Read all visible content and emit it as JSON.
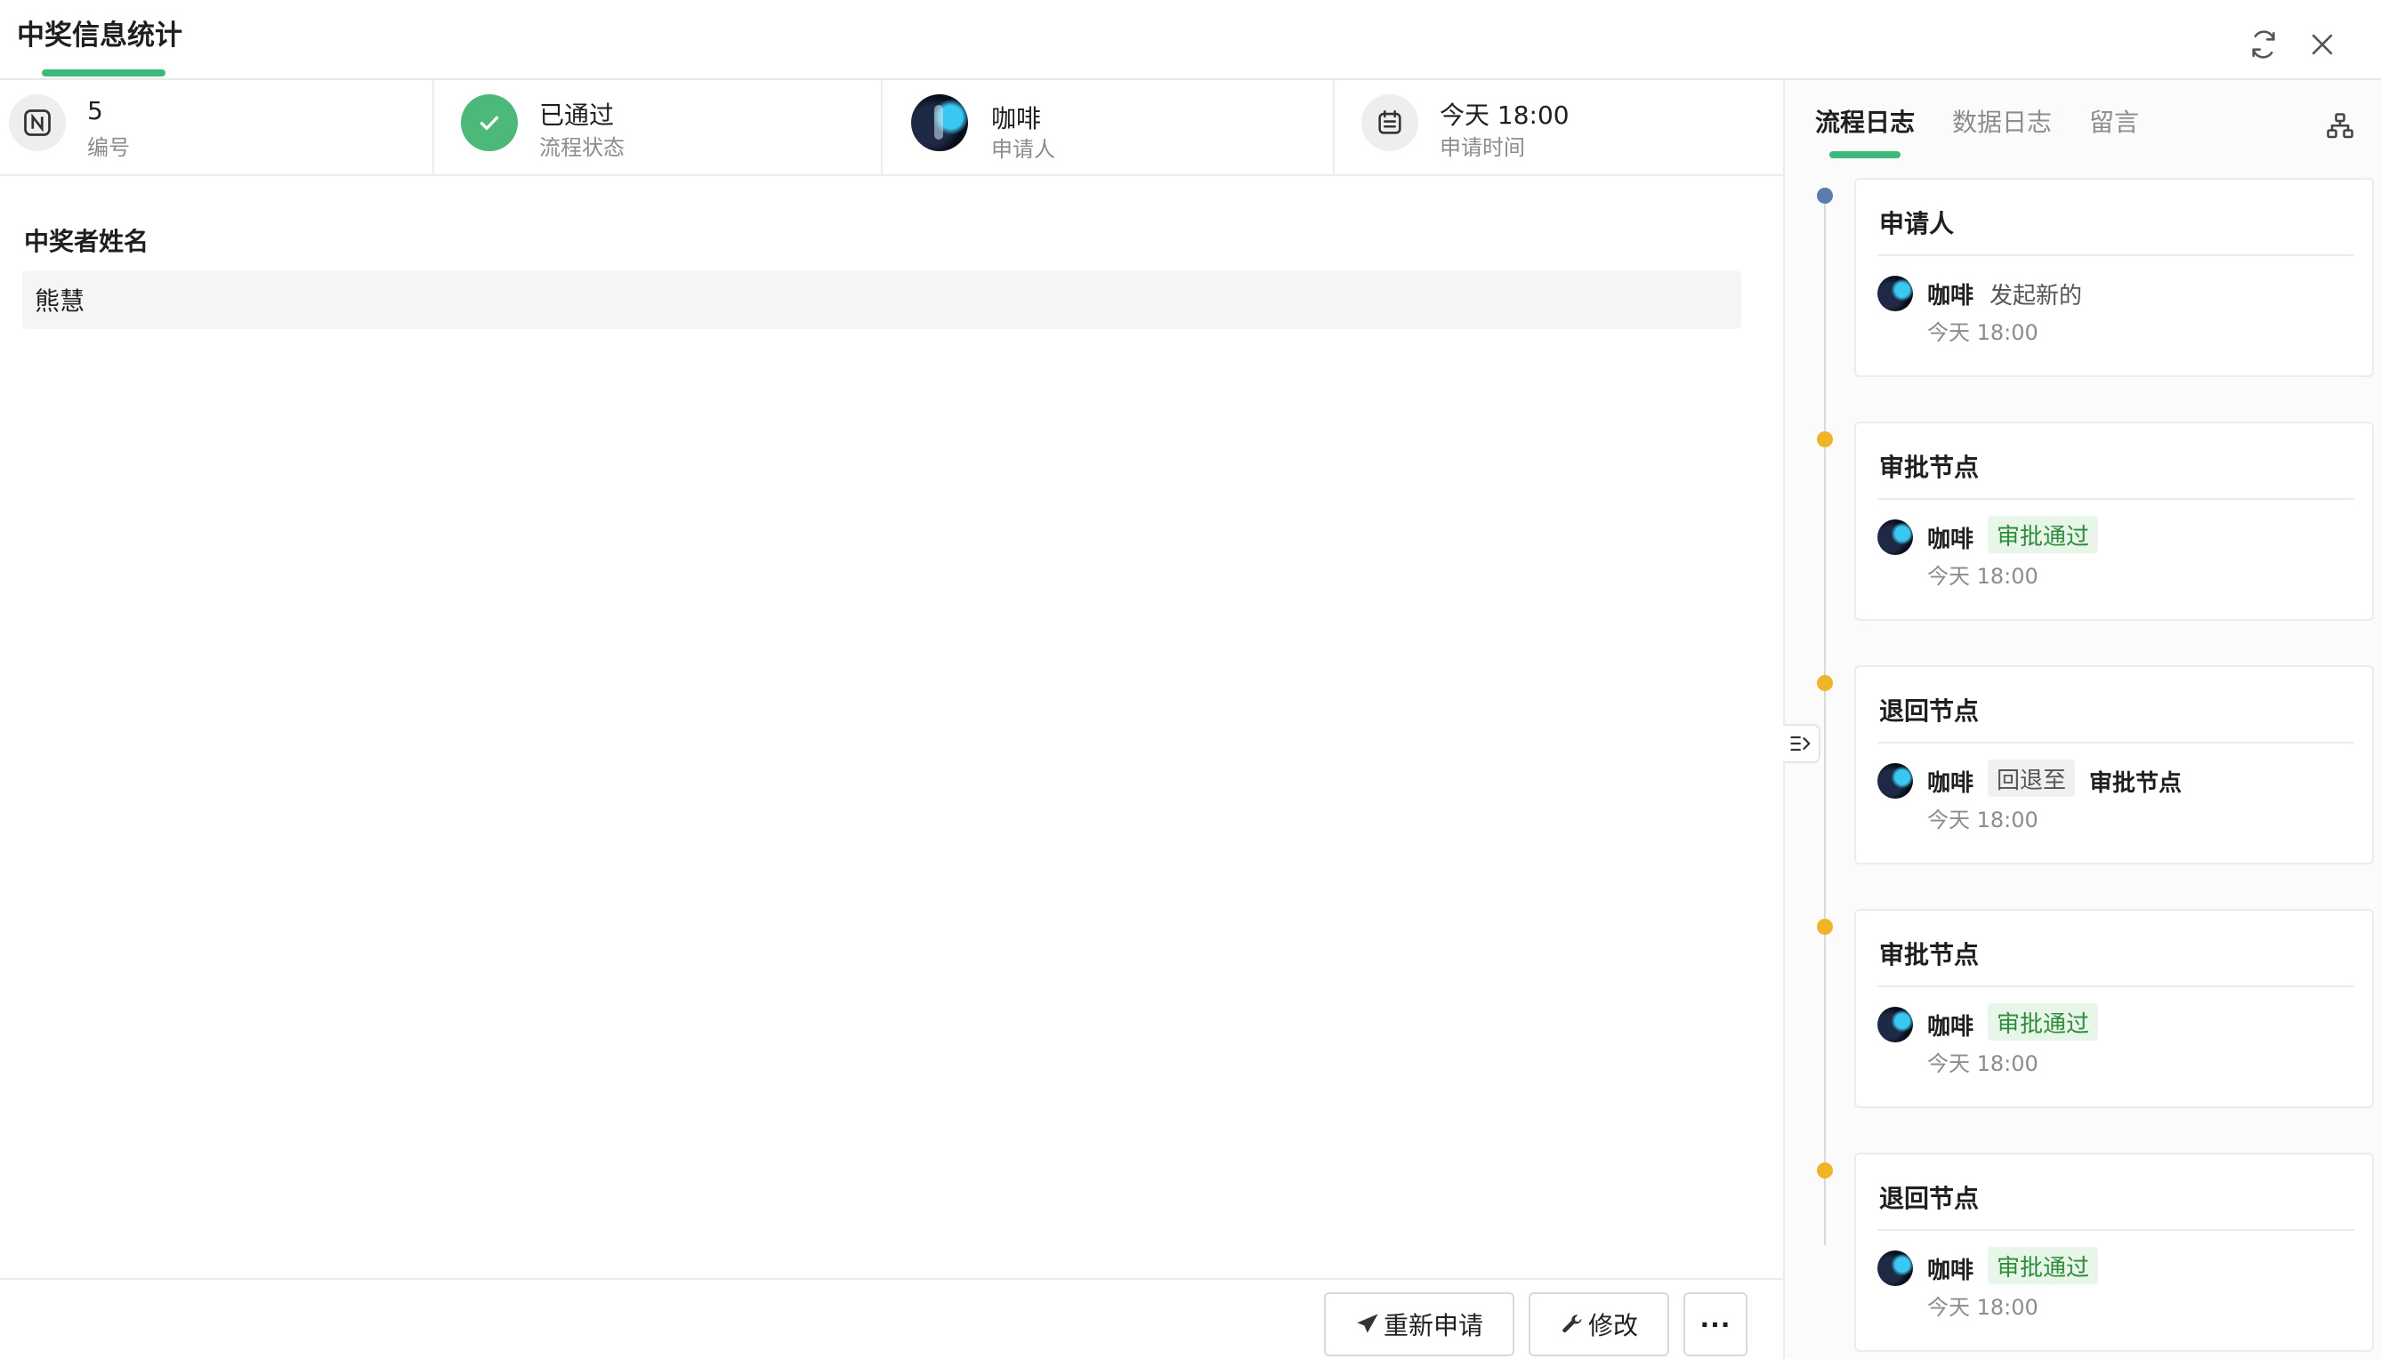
{
  "window": {
    "title": "中奖信息统计"
  },
  "info": {
    "number": {
      "value": "5",
      "label": "编号"
    },
    "status": {
      "value": "已通过",
      "label": "流程状态"
    },
    "applicant": {
      "value": "咖啡",
      "label": "申请人"
    },
    "time": {
      "value": "今天 18:00",
      "label": "申请时间"
    }
  },
  "form": {
    "field_label": "中奖者姓名",
    "field_value": "熊慧"
  },
  "footer": {
    "reapply_label": "重新申请",
    "edit_label": "修改",
    "more_label": "···"
  },
  "tabs": [
    {
      "label": "流程日志",
      "active": true
    },
    {
      "label": "数据日志",
      "active": false
    },
    {
      "label": "留言",
      "active": false
    }
  ],
  "timeline": [
    {
      "title": "申请人",
      "user": "咖啡",
      "action": "发起新的",
      "time": "今天 18:00",
      "dot_color": "#5b7ba8"
    },
    {
      "title": "审批节点",
      "user": "咖啡",
      "tag": "审批通过",
      "time": "今天 18:00",
      "dot_color": "#f0b429"
    },
    {
      "title": "退回节点",
      "user": "咖啡",
      "tag": "回退至",
      "target": "审批节点",
      "time": "今天 18:00",
      "dot_color": "#f0b429"
    },
    {
      "title": "审批节点",
      "user": "咖啡",
      "tag": "审批通过",
      "time": "今天 18:00",
      "dot_color": "#f0b429"
    },
    {
      "title": "退回节点",
      "user": "咖啡",
      "tag": "审批通过",
      "time": "今天 18:00",
      "dot_color": "#f0b429"
    }
  ],
  "colors": {
    "accent": "#3dba7a",
    "success": "#4cb87a",
    "tag_green_bg": "#e8f6e9",
    "tag_green_text": "#2e8b3a"
  }
}
